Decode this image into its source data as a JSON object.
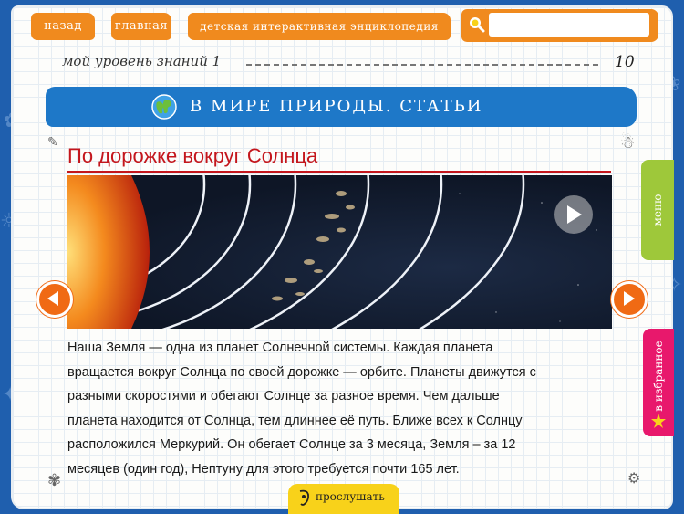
{
  "header": {
    "back_label": "назад",
    "main_label": "главная",
    "encyclopedia_label": "детская интерактивная энциклопедия",
    "search": {
      "placeholder": "",
      "value": ""
    }
  },
  "level": {
    "label": "мой уровень знаний",
    "value": "1",
    "max": "10"
  },
  "section": {
    "title": "В МИРЕ ПРИРОДЫ. СТАТЬИ",
    "icon": "globe-icon"
  },
  "article": {
    "title": "По дорожке вокруг Солнца",
    "paragraphs": [
      "Наша Земля — одна из планет Солнечной системы. Каждая планета",
      "вращается вокруг Солнца по своей дорожке — орбите. Планеты движутся с",
      "разными скоростями и обегают Солнце за разное время. Чем дальше",
      "планета находится от Солнца, тем длиннее её путь. Ближе всех к Солнцу",
      "расположился Меркурий. Он обегает Солнце за 3 месяца, Земля – за 12",
      "месяцев (один год), Нептуну для этого требуется почти 165 лет."
    ]
  },
  "side": {
    "menu_label": "меню",
    "favorites_label": "в избранное"
  },
  "footer": {
    "listen_label": "прослушать"
  },
  "colors": {
    "orange": "#f08a1e",
    "blue": "#1e78c8",
    "green": "#9ec83a",
    "pink": "#e8186c",
    "yellow": "#f8d21a",
    "title_red": "#c4161c"
  }
}
